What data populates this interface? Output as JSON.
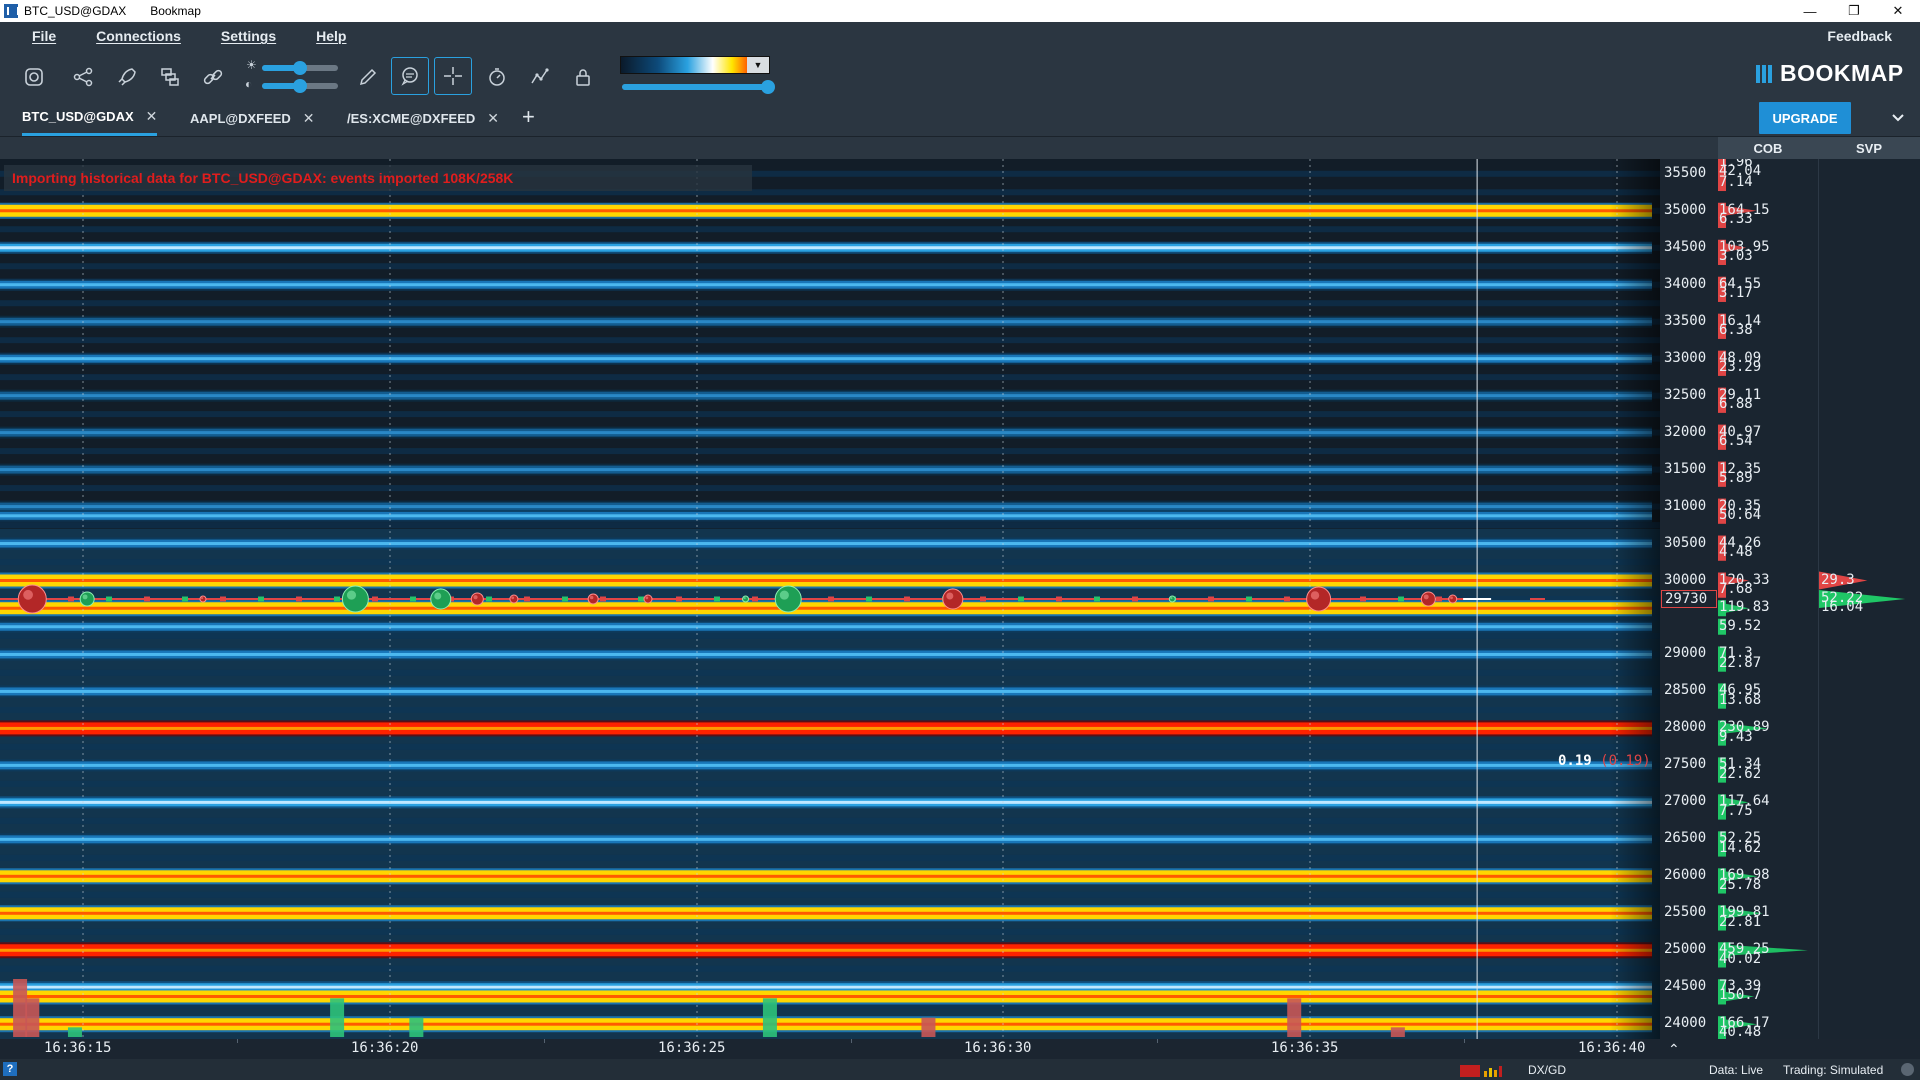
{
  "window": {
    "title": "BTC_USD@GDAX",
    "app_name": "Bookmap",
    "controls": [
      "minimize",
      "restore",
      "close"
    ]
  },
  "menu": {
    "items": [
      "File",
      "Connections",
      "Settings",
      "Help"
    ],
    "feedback": "Feedback"
  },
  "toolbar": {
    "icons": [
      "snapshot-icon",
      "share-icon",
      "rocket-icon",
      "layers-icon",
      "link-icon",
      "pencil-icon",
      "chat-icon",
      "crosshair-icon",
      "timer-icon",
      "chart-line-icon",
      "lock-icon"
    ],
    "active_icons": [
      "chat-icon",
      "crosshair-icon"
    ],
    "brightness_level": 0.5,
    "contrast_level": 0.5,
    "colormap_threshold_level": 1.0,
    "accent_color": "#2aa1e0"
  },
  "logo": {
    "text": "BOOKMAP"
  },
  "tabs": [
    {
      "label": "BTC_USD@GDAX",
      "active": true
    },
    {
      "label": "AAPL@DXFEED",
      "active": false
    },
    {
      "label": "/ES:XCME@DXFEED",
      "active": false
    }
  ],
  "upgrade_label": "UPGRADE",
  "panels": {
    "cob": "COB",
    "svp": "SVP"
  },
  "import_message": "Importing historical data for BTC_USD@GDAX: events imported 108K/258K",
  "crosshair": {
    "value": "0.19",
    "neg_value": "(0.19)"
  },
  "volume_label": "6",
  "price_axis": {
    "labels": [
      "35500",
      "35000",
      "34500",
      "34000",
      "33500",
      "33000",
      "32500",
      "32000",
      "31500",
      "31000",
      "30500",
      "30000",
      "29000",
      "28500",
      "28000",
      "27500",
      "27000",
      "26500",
      "26000",
      "25500",
      "25000",
      "24500",
      "24000"
    ],
    "current_price": "29730"
  },
  "cob_values": [
    {
      "price": 35650,
      "text": "1.96",
      "side": "ask",
      "size": 1.96
    },
    {
      "price": 35525,
      "text": "42.04",
      "side": "ask",
      "size": 42.04
    },
    {
      "price": 35375,
      "text": "7.14",
      "side": "ask",
      "size": 7.14
    },
    {
      "price": 35000,
      "text": "164.15",
      "side": "ask",
      "size": 164.15
    },
    {
      "price": 34875,
      "text": "6.33",
      "side": "ask",
      "size": 6.33
    },
    {
      "price": 34500,
      "text": "103.95",
      "side": "ask",
      "size": 103.95
    },
    {
      "price": 34375,
      "text": "3.03",
      "side": "ask",
      "size": 3.03
    },
    {
      "price": 34000,
      "text": "64.55",
      "side": "ask",
      "size": 64.55
    },
    {
      "price": 33875,
      "text": "3.17",
      "side": "ask",
      "size": 3.17
    },
    {
      "price": 33500,
      "text": "16.14",
      "side": "ask",
      "size": 16.14
    },
    {
      "price": 33375,
      "text": "6.38",
      "side": "ask",
      "size": 6.38
    },
    {
      "price": 33000,
      "text": "48.09",
      "side": "ask",
      "size": 48.09
    },
    {
      "price": 32875,
      "text": "23.29",
      "side": "ask",
      "size": 23.29
    },
    {
      "price": 32500,
      "text": "29.11",
      "side": "ask",
      "size": 29.11
    },
    {
      "price": 32375,
      "text": "6.88",
      "side": "ask",
      "size": 6.88
    },
    {
      "price": 32000,
      "text": "40.97",
      "side": "ask",
      "size": 40.97
    },
    {
      "price": 31875,
      "text": "6.54",
      "side": "ask",
      "size": 6.54
    },
    {
      "price": 31500,
      "text": "12.35",
      "side": "ask",
      "size": 12.35
    },
    {
      "price": 31375,
      "text": "5.89",
      "side": "ask",
      "size": 5.89
    },
    {
      "price": 31000,
      "text": "20.35",
      "side": "ask",
      "size": 20.35
    },
    {
      "price": 30875,
      "text": "50.64",
      "side": "ask",
      "size": 50.64
    },
    {
      "price": 30500,
      "text": "44.26",
      "side": "ask",
      "size": 44.26
    },
    {
      "price": 30375,
      "text": "4.48",
      "side": "ask",
      "size": 4.48
    },
    {
      "price": 30000,
      "text": "120.33",
      "side": "ask",
      "size": 120.33
    },
    {
      "price": 29875,
      "text": "7.68",
      "side": "ask",
      "size": 7.68
    },
    {
      "price": 29625,
      "text": "119.83",
      "side": "bid",
      "size": 119.83
    },
    {
      "price": 29375,
      "text": "59.52",
      "side": "bid",
      "size": 59.52
    },
    {
      "price": 29000,
      "text": "71.3",
      "side": "bid",
      "size": 71.3
    },
    {
      "price": 28875,
      "text": "22.87",
      "side": "bid",
      "size": 22.87
    },
    {
      "price": 28500,
      "text": "46.95",
      "side": "bid",
      "size": 46.95
    },
    {
      "price": 28375,
      "text": "13.68",
      "side": "bid",
      "size": 13.68
    },
    {
      "price": 28000,
      "text": "230.89",
      "side": "bid",
      "size": 230.89
    },
    {
      "price": 27875,
      "text": "9.43",
      "side": "bid",
      "size": 9.43
    },
    {
      "price": 27500,
      "text": "51.34",
      "side": "bid",
      "size": 51.34
    },
    {
      "price": 27375,
      "text": "22.62",
      "side": "bid",
      "size": 22.62
    },
    {
      "price": 27000,
      "text": "117.64",
      "side": "bid",
      "size": 117.64
    },
    {
      "price": 26875,
      "text": "7.75",
      "side": "bid",
      "size": 7.75
    },
    {
      "price": 26500,
      "text": "52.25",
      "side": "bid",
      "size": 52.25
    },
    {
      "price": 26375,
      "text": "14.62",
      "side": "bid",
      "size": 14.62
    },
    {
      "price": 26000,
      "text": "169.98",
      "side": "bid",
      "size": 169.98
    },
    {
      "price": 25875,
      "text": "25.78",
      "side": "bid",
      "size": 25.78
    },
    {
      "price": 25500,
      "text": "199.81",
      "side": "bid",
      "size": 199.81
    },
    {
      "price": 25375,
      "text": "22.81",
      "side": "bid",
      "size": 22.81
    },
    {
      "price": 25000,
      "text": "459.25",
      "side": "bid",
      "size": 459.25
    },
    {
      "price": 24875,
      "text": "40.02",
      "side": "bid",
      "size": 40.02
    },
    {
      "price": 24500,
      "text": "73.39",
      "side": "bid",
      "size": 73.39
    },
    {
      "price": 24375,
      "text": "150.7",
      "side": "bid",
      "size": 150.7
    },
    {
      "price": 24000,
      "text": "166.17",
      "side": "bid",
      "size": 166.17
    },
    {
      "price": 23875,
      "text": "40.48",
      "side": "bid",
      "size": 40.48
    }
  ],
  "svp_values": [
    {
      "price": 30000,
      "text": "29.3",
      "side": "ask",
      "size": 29.3
    },
    {
      "price": 29750,
      "text": "52.22",
      "side": "bid",
      "size": 52.22
    },
    {
      "price": 29625,
      "text": "16.04",
      "side": "neutral",
      "size": 16.04
    }
  ],
  "time_axis": {
    "labels": [
      "16:36:15",
      "16:36:20",
      "16:36:25",
      "16:36:30",
      "16:36:35",
      "16:36:40"
    ]
  },
  "heatmap": {
    "price_range": [
      23800,
      35700
    ],
    "time_range_seconds": [
      0,
      27
    ],
    "liquidity_levels": [
      {
        "price": 35000,
        "intensity": 0.95
      },
      {
        "price": 34500,
        "intensity": 0.55
      },
      {
        "price": 34000,
        "intensity": 0.42
      },
      {
        "price": 33500,
        "intensity": 0.2
      },
      {
        "price": 33000,
        "intensity": 0.3
      },
      {
        "price": 32500,
        "intensity": 0.25
      },
      {
        "price": 32000,
        "intensity": 0.28
      },
      {
        "price": 31500,
        "intensity": 0.18
      },
      {
        "price": 31000,
        "intensity": 0.22
      },
      {
        "price": 30875,
        "intensity": 0.35
      },
      {
        "price": 30500,
        "intensity": 0.35
      },
      {
        "price": 30000,
        "intensity": 0.92
      },
      {
        "price": 29625,
        "intensity": 0.9
      },
      {
        "price": 29375,
        "intensity": 0.45
      },
      {
        "price": 29000,
        "intensity": 0.45
      },
      {
        "price": 28500,
        "intensity": 0.38
      },
      {
        "price": 28000,
        "intensity": 1.0
      },
      {
        "price": 27500,
        "intensity": 0.42
      },
      {
        "price": 27000,
        "intensity": 0.55
      },
      {
        "price": 26500,
        "intensity": 0.42
      },
      {
        "price": 26000,
        "intensity": 0.9
      },
      {
        "price": 25500,
        "intensity": 0.95
      },
      {
        "price": 25000,
        "intensity": 1.0
      },
      {
        "price": 24500,
        "intensity": 0.5
      },
      {
        "price": 24375,
        "intensity": 0.88
      },
      {
        "price": 24000,
        "intensity": 0.92
      }
    ],
    "trades": [
      {
        "t": 0.3,
        "side": "sell",
        "size": 14
      },
      {
        "t": 1.2,
        "side": "buy",
        "size": 7
      },
      {
        "t": 3.1,
        "side": "sell",
        "size": 2
      },
      {
        "t": 5.6,
        "side": "buy",
        "size": 13
      },
      {
        "t": 7.0,
        "side": "buy",
        "size": 10
      },
      {
        "t": 7.6,
        "side": "sell",
        "size": 6
      },
      {
        "t": 8.2,
        "side": "sell",
        "size": 4
      },
      {
        "t": 9.5,
        "side": "sell",
        "size": 5
      },
      {
        "t": 10.4,
        "side": "sell",
        "size": 4
      },
      {
        "t": 12.0,
        "side": "buy",
        "size": 3
      },
      {
        "t": 12.7,
        "side": "buy",
        "size": 13
      },
      {
        "t": 15.4,
        "side": "sell",
        "size": 10
      },
      {
        "t": 19.0,
        "side": "buy",
        "size": 2
      },
      {
        "t": 21.4,
        "side": "sell",
        "size": 12
      },
      {
        "t": 23.2,
        "side": "sell",
        "size": 7
      },
      {
        "t": 23.6,
        "side": "sell",
        "size": 4
      }
    ],
    "volume_bars": [
      {
        "t": 0.1,
        "side": "sell",
        "size": 6
      },
      {
        "t": 0.3,
        "side": "sell",
        "size": 4
      },
      {
        "t": 1.0,
        "side": "buy",
        "size": 1
      },
      {
        "t": 5.3,
        "side": "buy",
        "size": 4
      },
      {
        "t": 6.6,
        "side": "buy",
        "size": 2
      },
      {
        "t": 12.4,
        "side": "buy",
        "size": 4
      },
      {
        "t": 15.0,
        "side": "sell",
        "size": 2
      },
      {
        "t": 21.0,
        "side": "sell",
        "size": 4
      },
      {
        "t": 22.7,
        "side": "sell",
        "size": 1
      }
    ],
    "cursor_time": 24.0
  }
}
